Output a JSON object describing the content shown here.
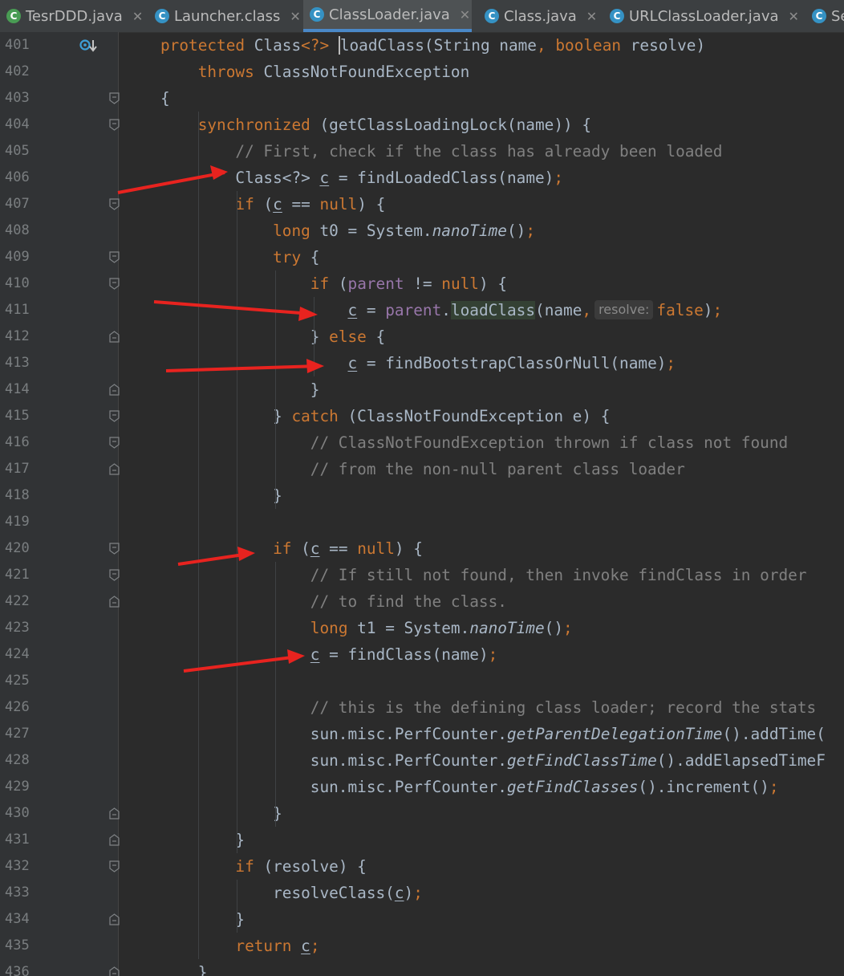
{
  "tabs": [
    {
      "name": "TesrDDD.java",
      "icon": "java-class-icon-green",
      "active": false
    },
    {
      "name": "Launcher.class",
      "icon": "class-file-icon",
      "active": false
    },
    {
      "name": "ClassLoader.java",
      "icon": "class-file-icon",
      "active": true
    },
    {
      "name": "Class.java",
      "icon": "class-file-icon",
      "active": false
    },
    {
      "name": "URLClassLoader.java",
      "icon": "class-file-icon",
      "active": false
    },
    {
      "name": "Se",
      "icon": "class-file-icon",
      "active": false
    }
  ],
  "lines": [
    {
      "num": "401",
      "tokens": [
        [
          "kw",
          "protected "
        ],
        [
          "fn",
          "Class"
        ],
        [
          "kw",
          "<?> "
        ],
        [
          "caret",
          ""
        ],
        [
          "fn",
          "loadClass(String name"
        ],
        [
          "kw",
          ", boolean "
        ],
        [
          "fn",
          "resolve)"
        ]
      ]
    },
    {
      "num": "402",
      "tokens": [
        [
          "fn",
          "    "
        ],
        [
          "kw",
          "throws "
        ],
        [
          "fn",
          "ClassNotFoundException"
        ]
      ]
    },
    {
      "num": "403",
      "tokens": [
        [
          "fn",
          "{"
        ]
      ]
    },
    {
      "num": "404",
      "tokens": [
        [
          "fn",
          "    "
        ],
        [
          "kw",
          "synchronized "
        ],
        [
          "fn",
          "(getClassLoadingLock(name)) {"
        ]
      ]
    },
    {
      "num": "405",
      "tokens": [
        [
          "cm",
          "        // First, check if the class has already been loaded"
        ]
      ]
    },
    {
      "num": "406",
      "tokens": [
        [
          "fn",
          "        Class<?> "
        ],
        [
          "ul",
          "c"
        ],
        [
          "fn",
          " = findLoadedClass(name)"
        ],
        [
          "kw",
          ";"
        ]
      ]
    },
    {
      "num": "407",
      "tokens": [
        [
          "fn",
          "        "
        ],
        [
          "kw",
          "if "
        ],
        [
          "fn",
          "("
        ],
        [
          "ul",
          "c"
        ],
        [
          "fn",
          " == "
        ],
        [
          "kw",
          "null"
        ],
        [
          "fn",
          ") {"
        ]
      ]
    },
    {
      "num": "408",
      "tokens": [
        [
          "fn",
          "            "
        ],
        [
          "kw",
          "long "
        ],
        [
          "fn",
          "t0 = System."
        ],
        [
          "it",
          "nanoTime"
        ],
        [
          "fn",
          "()"
        ],
        [
          "kw",
          ";"
        ]
      ]
    },
    {
      "num": "409",
      "tokens": [
        [
          "fn",
          "            "
        ],
        [
          "kw",
          "try "
        ],
        [
          "fn",
          "{"
        ]
      ]
    },
    {
      "num": "410",
      "tokens": [
        [
          "fn",
          "                "
        ],
        [
          "kw",
          "if "
        ],
        [
          "fn",
          "("
        ],
        [
          "purple",
          "parent"
        ],
        [
          "fn",
          " != "
        ],
        [
          "kw",
          "null"
        ],
        [
          "fn",
          ") {"
        ]
      ]
    },
    {
      "num": "411",
      "tokens": [
        [
          "fn",
          "                    "
        ],
        [
          "ul",
          "c"
        ],
        [
          "fn",
          " = "
        ],
        [
          "purple",
          "parent"
        ],
        [
          "fn",
          "."
        ],
        [
          "hl",
          "loadClass"
        ],
        [
          "fn",
          "(name"
        ],
        [
          "kw",
          ","
        ],
        [
          "hint",
          "resolve:"
        ],
        [
          "kw",
          "false"
        ],
        [
          "fn",
          ")"
        ],
        [
          "kw",
          ";"
        ]
      ]
    },
    {
      "num": "412",
      "tokens": [
        [
          "fn",
          "                } "
        ],
        [
          "kw",
          "else "
        ],
        [
          "fn",
          "{"
        ]
      ]
    },
    {
      "num": "413",
      "tokens": [
        [
          "fn",
          "                    "
        ],
        [
          "ul",
          "c"
        ],
        [
          "fn",
          " = findBootstrapClassOrNull(name)"
        ],
        [
          "kw",
          ";"
        ]
      ]
    },
    {
      "num": "414",
      "tokens": [
        [
          "fn",
          "                }"
        ]
      ]
    },
    {
      "num": "415",
      "tokens": [
        [
          "fn",
          "            } "
        ],
        [
          "kw",
          "catch "
        ],
        [
          "fn",
          "(ClassNotFoundException e) {"
        ]
      ]
    },
    {
      "num": "416",
      "tokens": [
        [
          "cm",
          "                // ClassNotFoundException thrown if class not found"
        ]
      ]
    },
    {
      "num": "417",
      "tokens": [
        [
          "cm",
          "                // from the non-null parent class loader"
        ]
      ]
    },
    {
      "num": "418",
      "tokens": [
        [
          "fn",
          "            }"
        ]
      ]
    },
    {
      "num": "419",
      "tokens": []
    },
    {
      "num": "420",
      "tokens": [
        [
          "fn",
          "            "
        ],
        [
          "kw",
          "if "
        ],
        [
          "fn",
          "("
        ],
        [
          "ul",
          "c"
        ],
        [
          "fn",
          " == "
        ],
        [
          "kw",
          "null"
        ],
        [
          "fn",
          ") {"
        ]
      ]
    },
    {
      "num": "421",
      "tokens": [
        [
          "cm",
          "                // If still not found, then invoke findClass in order"
        ]
      ]
    },
    {
      "num": "422",
      "tokens": [
        [
          "cm",
          "                // to find the class."
        ]
      ]
    },
    {
      "num": "423",
      "tokens": [
        [
          "fn",
          "                "
        ],
        [
          "kw",
          "long "
        ],
        [
          "fn",
          "t1 = System."
        ],
        [
          "it",
          "nanoTime"
        ],
        [
          "fn",
          "()"
        ],
        [
          "kw",
          ";"
        ]
      ]
    },
    {
      "num": "424",
      "tokens": [
        [
          "fn",
          "                "
        ],
        [
          "ul",
          "c"
        ],
        [
          "fn",
          " = findClass(name)"
        ],
        [
          "kw",
          ";"
        ]
      ]
    },
    {
      "num": "425",
      "tokens": []
    },
    {
      "num": "426",
      "tokens": [
        [
          "cm",
          "                // this is the defining class loader; record the stats"
        ]
      ]
    },
    {
      "num": "427",
      "tokens": [
        [
          "fn",
          "                sun.misc.PerfCounter."
        ],
        [
          "it",
          "getParentDelegationTime"
        ],
        [
          "fn",
          "().addTime("
        ]
      ]
    },
    {
      "num": "428",
      "tokens": [
        [
          "fn",
          "                sun.misc.PerfCounter."
        ],
        [
          "it",
          "getFindClassTime"
        ],
        [
          "fn",
          "().addElapsedTimeF"
        ]
      ]
    },
    {
      "num": "429",
      "tokens": [
        [
          "fn",
          "                sun.misc.PerfCounter."
        ],
        [
          "it",
          "getFindClasses"
        ],
        [
          "fn",
          "().increment()"
        ],
        [
          "kw",
          ";"
        ]
      ]
    },
    {
      "num": "430",
      "tokens": [
        [
          "fn",
          "            }"
        ]
      ]
    },
    {
      "num": "431",
      "tokens": [
        [
          "fn",
          "        }"
        ]
      ]
    },
    {
      "num": "432",
      "tokens": [
        [
          "fn",
          "        "
        ],
        [
          "kw",
          "if "
        ],
        [
          "fn",
          "(resolve) {"
        ]
      ]
    },
    {
      "num": "433",
      "tokens": [
        [
          "fn",
          "            resolveClass("
        ],
        [
          "ul",
          "c"
        ],
        [
          "fn",
          ")"
        ],
        [
          "kw",
          ";"
        ]
      ]
    },
    {
      "num": "434",
      "tokens": [
        [
          "fn",
          "        }"
        ]
      ]
    },
    {
      "num": "435",
      "tokens": [
        [
          "fn",
          "        "
        ],
        [
          "kw",
          "return "
        ],
        [
          "ul",
          "c"
        ],
        [
          "kw",
          ";"
        ]
      ]
    },
    {
      "num": "436",
      "tokens": [
        [
          "fn",
          "    }"
        ]
      ]
    }
  ],
  "colors": {
    "background": "#2b2b2b",
    "keyword": "#cc7832",
    "comment": "#808080",
    "text": "#a9b7c6",
    "field": "#9876aa",
    "arrow": "#e8231f",
    "active_tab_accent": "#4a88c7"
  }
}
